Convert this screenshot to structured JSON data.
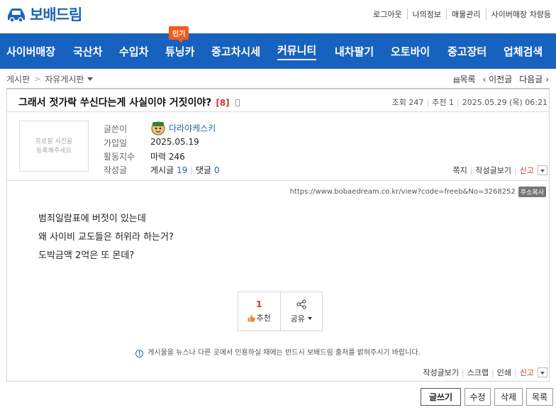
{
  "brand": {
    "name": "보배드림"
  },
  "top_links": [
    "로그아웃",
    "나의정보",
    "매물관리",
    "사이버매장 차량등"
  ],
  "nav": {
    "items": [
      "사이버매장",
      "국산차",
      "수입차",
      "튜닝카",
      "중고차시세",
      "커뮤니티",
      "내차팔기",
      "오토바이",
      "중고장터",
      "업체검색"
    ],
    "active": "커뮤니티",
    "hot_badge": "인기"
  },
  "breadcrumb": {
    "root": "게시판",
    "separator": ">",
    "current": "자유게시판"
  },
  "post_nav": {
    "list": "목록",
    "prev": "이전글",
    "next": "다음글"
  },
  "post": {
    "title": "그래서 젓가락 쑤신다는게 사실이야 거짓이야?",
    "comment_count": "[8]",
    "views_label": "조회",
    "views": "247",
    "recommend_label": "추천",
    "recommend": "1",
    "date": "2025.05.29 (목) 06:21",
    "url": "https://www.bobaedream.co.kr/view?code=freeb&No=3268252",
    "copy_label": "주소복사",
    "body": [
      "범죄일람표에 버젓이 있는데",
      "왜 사이비 교도들은 허위라 하는거?",
      "도박금액 2억은 또 몬데?"
    ]
  },
  "author": {
    "photo_placeholder_line1": "프로필 사진을",
    "photo_placeholder_line2": "등록해주세요",
    "writer_label": "글쓴이",
    "nickname": "다라야케스키",
    "joined_label": "가입일",
    "joined": "2025.05.19",
    "activity_label": "활동지수",
    "activity": "마력 246",
    "posts_label": "작성글",
    "posts_text": "게시글",
    "posts": "19",
    "comments_text": "댓글",
    "comments": "0"
  },
  "profile_links": {
    "message": "쪽지",
    "view_posts": "작성글보기",
    "report": "신고"
  },
  "reco_box": {
    "count": "1",
    "recommend": "추천",
    "share": "공유"
  },
  "notice": "게시물을 뉴스나 다른 곳에서 인용하실 때에는 반드시 보배드림 출처를 밝혀주시기 바랍니다.",
  "footer_links": {
    "view_posts": "작성글보기",
    "scrap": "스크랩",
    "print": "인쇄",
    "report": "신고"
  },
  "bottom_buttons": {
    "write": "글쓰기",
    "edit": "수정",
    "delete": "삭제",
    "list": "목록"
  },
  "colors": {
    "nav_bg": "#1762be",
    "brand_blue": "#1c64b8",
    "hot_badge": "#f45b1e",
    "red": "#d9302f"
  }
}
